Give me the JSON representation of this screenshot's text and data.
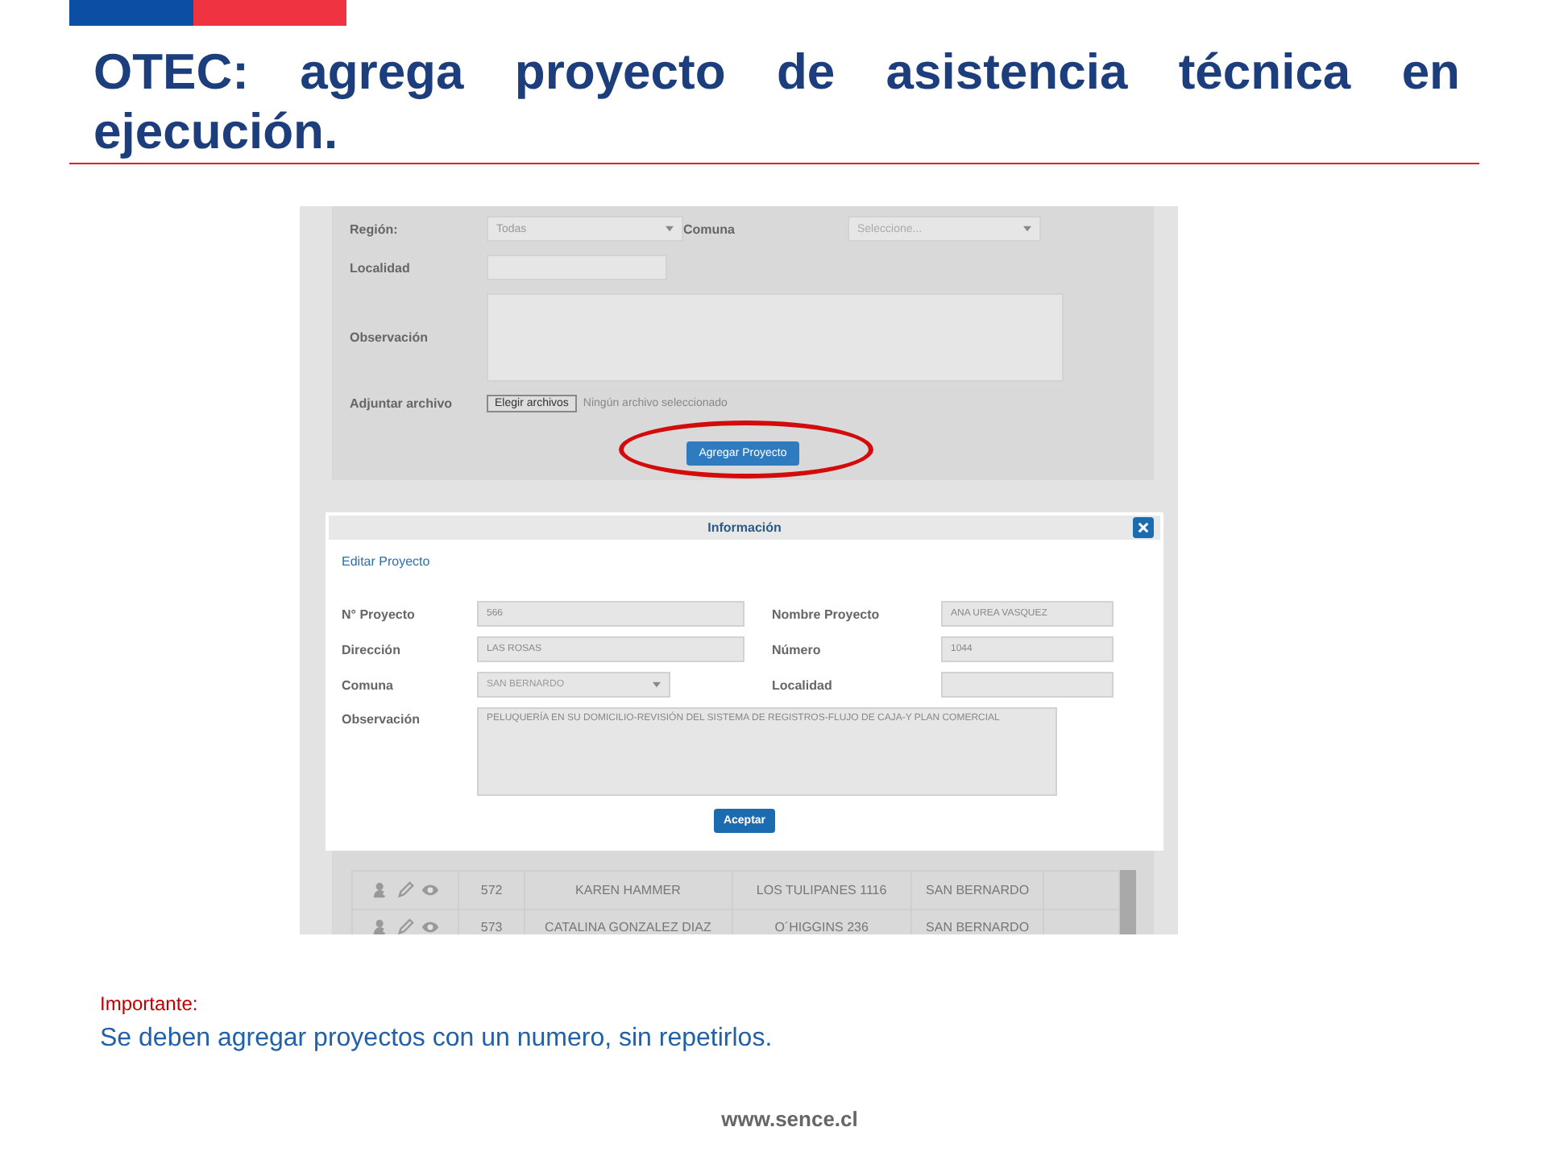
{
  "slide": {
    "title": "OTEC: agrega proyecto de asistencia técnica en ejecución.",
    "note_label": "Importante:",
    "note_text": "Se deben agregar proyectos con un numero, sin repetirlos.",
    "footer": "www.sence.cl"
  },
  "form": {
    "fields": [
      {
        "kind": "select",
        "label": "Región:",
        "value": "Todas"
      },
      {
        "kind": "select",
        "label": "Comuna",
        "placeholder": "Seleccione..."
      },
      {
        "kind": "text",
        "label": "Localidad"
      },
      {
        "kind": "textarea",
        "label": "Observación"
      },
      {
        "kind": "file",
        "label": "Adjuntar archivo",
        "button": "Elegir archivos",
        "status": "Ningún archivo seleccionado"
      }
    ],
    "submit": "Agregar Proyecto"
  },
  "dialog": {
    "title": "Información",
    "subtitle": "Editar Proyecto",
    "fields": [
      {
        "kind": "text",
        "label": "N° Proyecto",
        "value": "566"
      },
      {
        "kind": "text",
        "label": "Nombre Proyecto",
        "value": "ANA UREA VASQUEZ"
      },
      {
        "kind": "text",
        "label": "Dirección",
        "value": "LAS ROSAS"
      },
      {
        "kind": "text",
        "label": "Número",
        "value": "1044"
      },
      {
        "kind": "select",
        "label": "Comuna",
        "value": "SAN BERNARDO"
      },
      {
        "kind": "text",
        "label": "Localidad"
      },
      {
        "kind": "textarea",
        "label": "Observación",
        "value": "PELUQUERÍA EN SU DOMICILIO-REVISIÓN DEL SISTEMA DE REGISTROS-FLUJO DE CAJA-Y PLAN COMERCIAL"
      }
    ],
    "button": "Aceptar"
  },
  "table": {
    "rows": [
      {
        "number": "572",
        "name": "KAREN HAMMER",
        "address": "LOS TULIPANES 1116",
        "commune": "SAN BERNARDO"
      },
      {
        "number": "573",
        "name": "CATALINA GONZALEZ DIAZ",
        "address": "O´HIGGINS  236",
        "commune": "SAN BERNARDO"
      }
    ]
  }
}
